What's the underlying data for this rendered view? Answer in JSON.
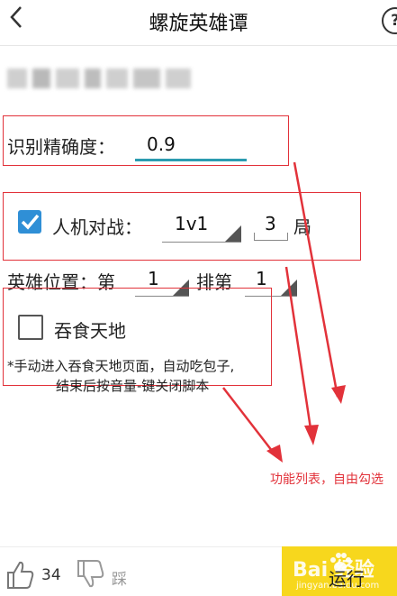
{
  "header": {
    "back_icon": "chevron-left-icon",
    "title": "螺旋英雄谭",
    "help_label": "?"
  },
  "settings": {
    "accuracy": {
      "label": "识别精确度：",
      "value": "0.9"
    },
    "pve": {
      "label": "人机对战：",
      "checked": true,
      "mode_value": "1v1",
      "rounds_value": "3",
      "rounds_unit": "局"
    },
    "position": {
      "label": "英雄位置：第",
      "column_value": "1",
      "row_label": "排第",
      "row_value": "1"
    },
    "devour": {
      "label": "吞食天地",
      "checked": false,
      "note_line1": "*手动进入吞食天地页面，自动吃包子,",
      "note_line2": "结束后按音量-键关闭脚本"
    }
  },
  "annotation": {
    "text": "功能列表，自由勾选",
    "color": "#e2323a"
  },
  "footer": {
    "like_count": "34",
    "dislike_label": "踩",
    "run_label": "运行",
    "run_color": "#f7d71d",
    "watermark": "Bai  经验",
    "watermark_sub": "jingyan.baidu.com"
  }
}
